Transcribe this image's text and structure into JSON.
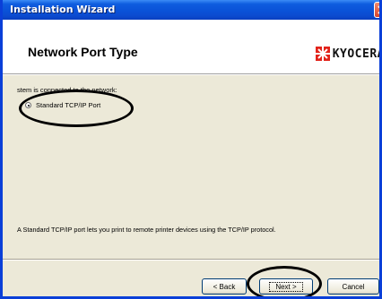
{
  "window": {
    "title": "Installation Wizard",
    "close_icon": "close-icon"
  },
  "header": {
    "title": "Network Port Type",
    "logo_text": "KYOCERA",
    "logo_color": "#e2231a"
  },
  "main": {
    "prompt": "stem is connected to the network:",
    "option_selected": "Standard TCP/IP Port",
    "option_faded": "",
    "description": "A Standard TCP/IP port lets you print to remote printer devices using the TCP/IP protocol."
  },
  "buttons": {
    "back": "< Back",
    "next": "Next >",
    "cancel": "Cancel"
  },
  "colors": {
    "titlebar": "#0a52d8",
    "window_bg": "#ece9d8",
    "button_border": "#003c74"
  }
}
